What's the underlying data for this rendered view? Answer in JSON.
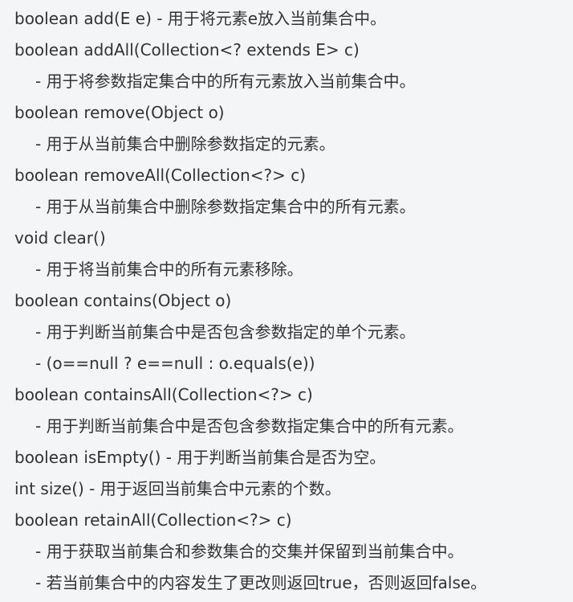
{
  "lines": [
    "boolean add(E e) - 用于将元素e放入当前集合中。",
    "boolean addAll(Collection<? extends E> c)",
    "- 用于将参数指定集合中的所有元素放入当前集合中。",
    "boolean remove(Object o)",
    "- 用于从当前集合中删除参数指定的元素。",
    "boolean removeAll(Collection<?> c)",
    "- 用于从当前集合中删除参数指定集合中的所有元素。",
    "void clear()",
    "- 用于将当前集合中的所有元素移除。",
    "boolean contains(Object o)",
    "- 用于判断当前集合中是否包含参数指定的单个元素。",
    "- (o==null ? e==null : o.equals(e))",
    "boolean containsAll(Collection<?> c)",
    "- 用于判断当前集合中是否包含参数指定集合中的所有元素。",
    "boolean isEmpty() - 用于判断当前集合是否为空。",
    "int size() - 用于返回当前集合中元素的个数。",
    "boolean retainAll(Collection<?> c)",
    "- 用于获取当前集合和参数集合的交集并保留到当前集合中。",
    "- 若当前集合中的内容发生了更改则返回true，否则返回false。"
  ],
  "colors": {
    "background": "#f4f5f7",
    "text": "#333333"
  }
}
